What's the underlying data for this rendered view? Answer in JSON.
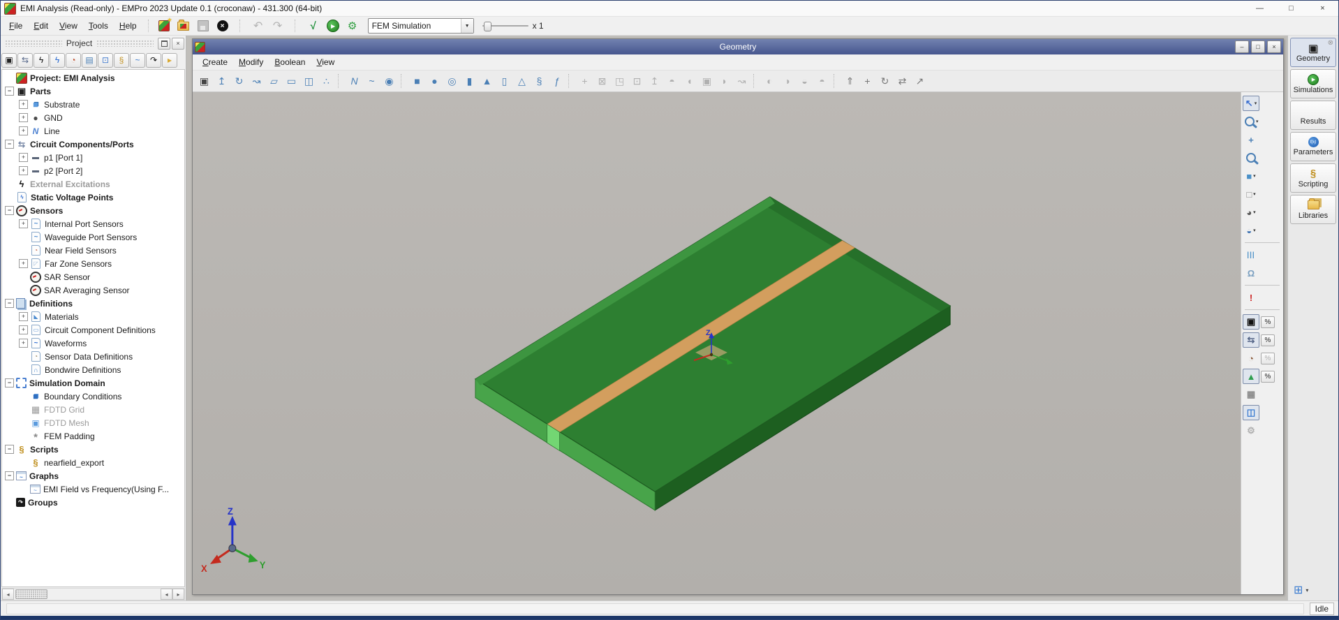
{
  "app": {
    "title": "EMI Analysis (Read-only) - EMPro 2023 Update 0.1 (croconaw) - 431.300 (64-bit)",
    "controls": {
      "minimize": "—",
      "maximize": "□",
      "close": "×"
    }
  },
  "menus": [
    "File",
    "Edit",
    "View",
    "Tools",
    "Help"
  ],
  "toolbar": {
    "sim_select": "FEM Simulation",
    "speed_label": "x 1",
    "buttons": [
      {
        "name": "new-project"
      },
      {
        "name": "open-project"
      },
      {
        "name": "save-project",
        "disabled": true
      },
      {
        "name": "abort"
      },
      {
        "sep": true
      },
      {
        "name": "undo",
        "disabled": true
      },
      {
        "name": "redo",
        "disabled": true
      },
      {
        "sep": true
      },
      {
        "name": "validate"
      },
      {
        "name": "run-simulation"
      },
      {
        "name": "setup-wrench"
      }
    ]
  },
  "project": {
    "title": "Project",
    "toolbar": [
      {
        "name": "parts-filter",
        "glyph": "▣",
        "color": "#222"
      },
      {
        "name": "components-filter",
        "glyph": "⇆",
        "color": "#556688"
      },
      {
        "name": "excitations-filter",
        "glyph": "ϟ",
        "color": "#111"
      },
      {
        "name": "voltage-filter",
        "glyph": "ϟ",
        "color": "#2a6ad0"
      },
      {
        "name": "sensors-filter",
        "glyph": "◔",
        "color": "#c05030"
      },
      {
        "name": "definitions-filter",
        "glyph": "▤",
        "color": "#4a7fb5"
      },
      {
        "name": "domain-filter",
        "glyph": "⊡",
        "color": "#4a7fd0"
      },
      {
        "name": "scripts-filter",
        "glyph": "§",
        "color": "#c09020"
      },
      {
        "name": "graphs-filter",
        "glyph": "~",
        "color": "#3a7bd0"
      },
      {
        "name": "groups-filter",
        "glyph": "↷",
        "color": "#111"
      },
      {
        "name": "libraries-filter",
        "glyph": "▸",
        "color": "#d8a830"
      }
    ],
    "tree": [
      {
        "label": "Project: EMI Analysis",
        "icon": "empro-logo",
        "level": 0,
        "bold": true
      },
      {
        "label": "Parts",
        "icon": "parts",
        "level": 0,
        "bold": true,
        "expand": "-"
      },
      {
        "label": "Substrate",
        "icon": "cube",
        "level": 1,
        "expand": "+"
      },
      {
        "label": "GND",
        "icon": "solid",
        "level": 1,
        "expand": "+"
      },
      {
        "label": "Line",
        "icon": "polyline",
        "level": 1,
        "expand": "+"
      },
      {
        "label": "Circuit Components/Ports",
        "icon": "circuit-port",
        "level": 0,
        "bold": true,
        "expand": "-"
      },
      {
        "label": "p1 [Port 1]",
        "icon": "port",
        "level": 1,
        "expand": "+"
      },
      {
        "label": "p2 [Port 2]",
        "icon": "port",
        "level": 1,
        "expand": "+"
      },
      {
        "label": "External Excitations",
        "icon": "lightning",
        "level": 0,
        "bold": true,
        "gray": true
      },
      {
        "label": "Static Voltage Points",
        "icon": "voltage-point",
        "level": 0,
        "bold": true,
        "page": true
      },
      {
        "label": "Sensors",
        "icon": "gauge",
        "level": 0,
        "bold": true,
        "expand": "-"
      },
      {
        "label": "Internal Port Sensors",
        "icon": "port-sensor",
        "level": 1,
        "expand": "+",
        "page": true
      },
      {
        "label": "Waveguide Port Sensors",
        "icon": "port-sensor",
        "level": 1,
        "page": true
      },
      {
        "label": "Near Field Sensors",
        "icon": "near-field-sensor",
        "level": 1,
        "page": true
      },
      {
        "label": "Far Zone Sensors",
        "icon": "far-zone-sensor",
        "level": 1,
        "expand": "+",
        "page": true
      },
      {
        "label": "SAR Sensor",
        "icon": "gauge",
        "level": 1
      },
      {
        "label": "SAR Averaging Sensor",
        "icon": "gauge",
        "level": 1
      },
      {
        "label": "Definitions",
        "icon": "definitions",
        "level": 0,
        "bold": true,
        "expand": "-"
      },
      {
        "label": "Materials",
        "icon": "materials",
        "level": 1,
        "expand": "+",
        "page": true
      },
      {
        "label": "Circuit Component Definitions",
        "icon": "circuit-def",
        "level": 1,
        "expand": "+",
        "page": true
      },
      {
        "label": "Waveforms",
        "icon": "waveform",
        "level": 1,
        "expand": "+",
        "page": true
      },
      {
        "label": "Sensor Data Definitions",
        "icon": "sensor-data",
        "level": 1,
        "page": true
      },
      {
        "label": "Bondwire Definitions",
        "icon": "bondwire",
        "level": 1,
        "page": true
      },
      {
        "label": "Simulation Domain",
        "icon": "sim-domain",
        "level": 0,
        "bold": true,
        "expand": "-"
      },
      {
        "label": "Boundary Conditions",
        "icon": "boundary",
        "level": 1
      },
      {
        "label": "FDTD Grid",
        "icon": "fdtd-grid",
        "level": 1,
        "gray": true
      },
      {
        "label": "FDTD Mesh",
        "icon": "fdtd-mesh",
        "level": 1,
        "gray": true
      },
      {
        "label": "FEM Padding",
        "icon": "fem-padding",
        "level": 1
      },
      {
        "label": "Scripts",
        "icon": "script",
        "level": 0,
        "bold": true,
        "expand": "-"
      },
      {
        "label": "nearfield_export",
        "icon": "script",
        "level": 1
      },
      {
        "label": "Graphs",
        "icon": "graph",
        "level": 0,
        "bold": true,
        "expand": "-"
      },
      {
        "label": "EMI Field vs Frequency(Using F...",
        "icon": "graph-item",
        "level": 1
      },
      {
        "label": "Groups",
        "icon": "groups",
        "level": 0,
        "bold": true
      }
    ]
  },
  "geometry": {
    "title": "Geometry",
    "controls": {
      "minimize": "–",
      "restore": "□",
      "close": "×"
    },
    "menus": [
      "Create",
      "Modify",
      "Boolean",
      "View"
    ],
    "toolbar_groups": [
      [
        {
          "name": "create-part",
          "glyph": "▣",
          "color": "#444"
        },
        {
          "name": "extrude",
          "glyph": "↥"
        },
        {
          "name": "revolve",
          "glyph": "↻"
        },
        {
          "name": "sweep",
          "glyph": "↝"
        },
        {
          "name": "loft",
          "glyph": "▱"
        },
        {
          "name": "sheet-body",
          "glyph": "▭"
        },
        {
          "name": "open-box",
          "glyph": "◫"
        },
        {
          "name": "wire-body",
          "glyph": "∴"
        }
      ],
      [
        {
          "name": "polyline",
          "glyph": "N"
        },
        {
          "name": "spline",
          "glyph": "~"
        },
        {
          "name": "geodesic-sphere",
          "glyph": "◉"
        }
      ],
      [
        {
          "name": "box",
          "glyph": "■"
        },
        {
          "name": "sphere",
          "glyph": "●"
        },
        {
          "name": "torus",
          "glyph": "◎"
        },
        {
          "name": "cylinder",
          "glyph": "▮"
        },
        {
          "name": "cone",
          "glyph": "▲"
        },
        {
          "name": "prism",
          "glyph": "▯"
        },
        {
          "name": "pyramid",
          "glyph": "△"
        },
        {
          "name": "helix",
          "glyph": "§"
        },
        {
          "name": "parametric-part",
          "glyph": "ƒ"
        }
      ],
      [
        {
          "name": "move-tool",
          "glyph": "+",
          "disabled": true
        },
        {
          "name": "delete-face",
          "glyph": "⊠",
          "disabled": true
        },
        {
          "name": "detach-face",
          "glyph": "◳",
          "disabled": true
        },
        {
          "name": "imprint",
          "glyph": "⊡",
          "disabled": true
        },
        {
          "name": "extrude-face",
          "glyph": "↥",
          "disabled": true
        },
        {
          "name": "cover",
          "glyph": "◓",
          "disabled": true
        },
        {
          "name": "round-edge",
          "glyph": "◖",
          "disabled": true
        },
        {
          "name": "shell",
          "glyph": "▣",
          "disabled": true
        },
        {
          "name": "blend",
          "glyph": "◗",
          "disabled": true
        },
        {
          "name": "bend",
          "glyph": "↝",
          "disabled": true
        }
      ],
      [
        {
          "name": "boolean-union",
          "glyph": "◐",
          "disabled": true
        },
        {
          "name": "boolean-subtract",
          "glyph": "◑",
          "disabled": true
        },
        {
          "name": "boolean-intersect",
          "glyph": "◒",
          "disabled": true
        },
        {
          "name": "boolean-chop",
          "glyph": "◓",
          "disabled": true
        }
      ],
      [
        {
          "name": "translate-part",
          "glyph": "⇑",
          "color": "#777"
        },
        {
          "name": "move-part",
          "glyph": "+",
          "color": "#777"
        },
        {
          "name": "rotate-part",
          "glyph": "↻",
          "color": "#777"
        },
        {
          "name": "mirror-part",
          "glyph": "⇄",
          "color": "#777"
        },
        {
          "name": "shear-part",
          "glyph": "↗",
          "color": "#777"
        }
      ]
    ],
    "side_toolbar": [
      {
        "name": "select-tool",
        "glyph": "↖",
        "color": "#3a6fd0",
        "pressed": true,
        "dd": true
      },
      {
        "name": "zoom-window-tool",
        "css": "mag",
        "dd": true
      },
      {
        "name": "pan-tool",
        "glyph": "+",
        "color": "#4a7fb5"
      },
      {
        "name": "zoom-parts-tool",
        "css": "mag"
      },
      {
        "name": "view-solid-mode",
        "glyph": "■",
        "color": "#4a90c8",
        "dd": true
      },
      {
        "name": "view-open-mode",
        "glyph": "□",
        "color": "#8a8a8a",
        "dd": true
      },
      {
        "name": "orient-view",
        "glyph": "◕",
        "color": "#555555",
        "dd": true
      },
      {
        "name": "lens-view",
        "glyph": "◒",
        "color": "#3a6fb0",
        "dd": true
      },
      {
        "sep": true
      },
      {
        "name": "scale-bars",
        "glyph": "|||",
        "color": "#4a90c8"
      },
      {
        "name": "impedance-display",
        "glyph": "Ω",
        "color": "#7a9fc0"
      },
      {
        "sep": true
      },
      {
        "name": "thermal-display",
        "glyph": "!",
        "color": "#cc2222"
      },
      {
        "sep": true
      },
      {
        "name": "show-parts",
        "glyph": "▣",
        "color": "#111",
        "pressed": true,
        "pct": true
      },
      {
        "name": "show-ports",
        "glyph": "⇆",
        "color": "#556688",
        "pressed": true,
        "pct": true
      },
      {
        "name": "show-sensors",
        "glyph": "◔",
        "color": "#8a5a3a",
        "pct": true,
        "pct_disabled": true
      },
      {
        "name": "show-far-zones",
        "glyph": "▲",
        "color": "#2e9e4f",
        "pressed": true,
        "pct": true
      },
      {
        "name": "show-mesh",
        "glyph": "▦",
        "color": "#8a8a8a"
      },
      {
        "name": "show-field-results",
        "glyph": "◫",
        "color": "#3a7bd0",
        "pressed": true
      },
      {
        "name": "show-tools",
        "glyph": "⚙",
        "color": "#b0b0b0"
      }
    ],
    "scene": {
      "axis_z": "Z",
      "axis_x": "X",
      "axis_y": "Y",
      "origin_z": "Z",
      "colors": {
        "viewport_bg": "#b8b5b1",
        "pcb_top": "#2d7f31",
        "pcb_side_light": "#48a44a",
        "pcb_side_dark": "#1d5f20",
        "trace_copper": "#d39e5e",
        "port_marker": "#73d673"
      }
    }
  },
  "right_tabs": [
    {
      "label": "Geometry",
      "icon": "geometry",
      "active": true
    },
    {
      "label": "Simulations",
      "icon": "simulations"
    },
    {
      "label": "Results",
      "icon": "results"
    },
    {
      "label": "Parameters",
      "icon": "parameters"
    },
    {
      "label": "Scripting",
      "icon": "scripting"
    },
    {
      "label": "Libraries",
      "icon": "libraries"
    }
  ],
  "status": {
    "text": "Idle"
  }
}
